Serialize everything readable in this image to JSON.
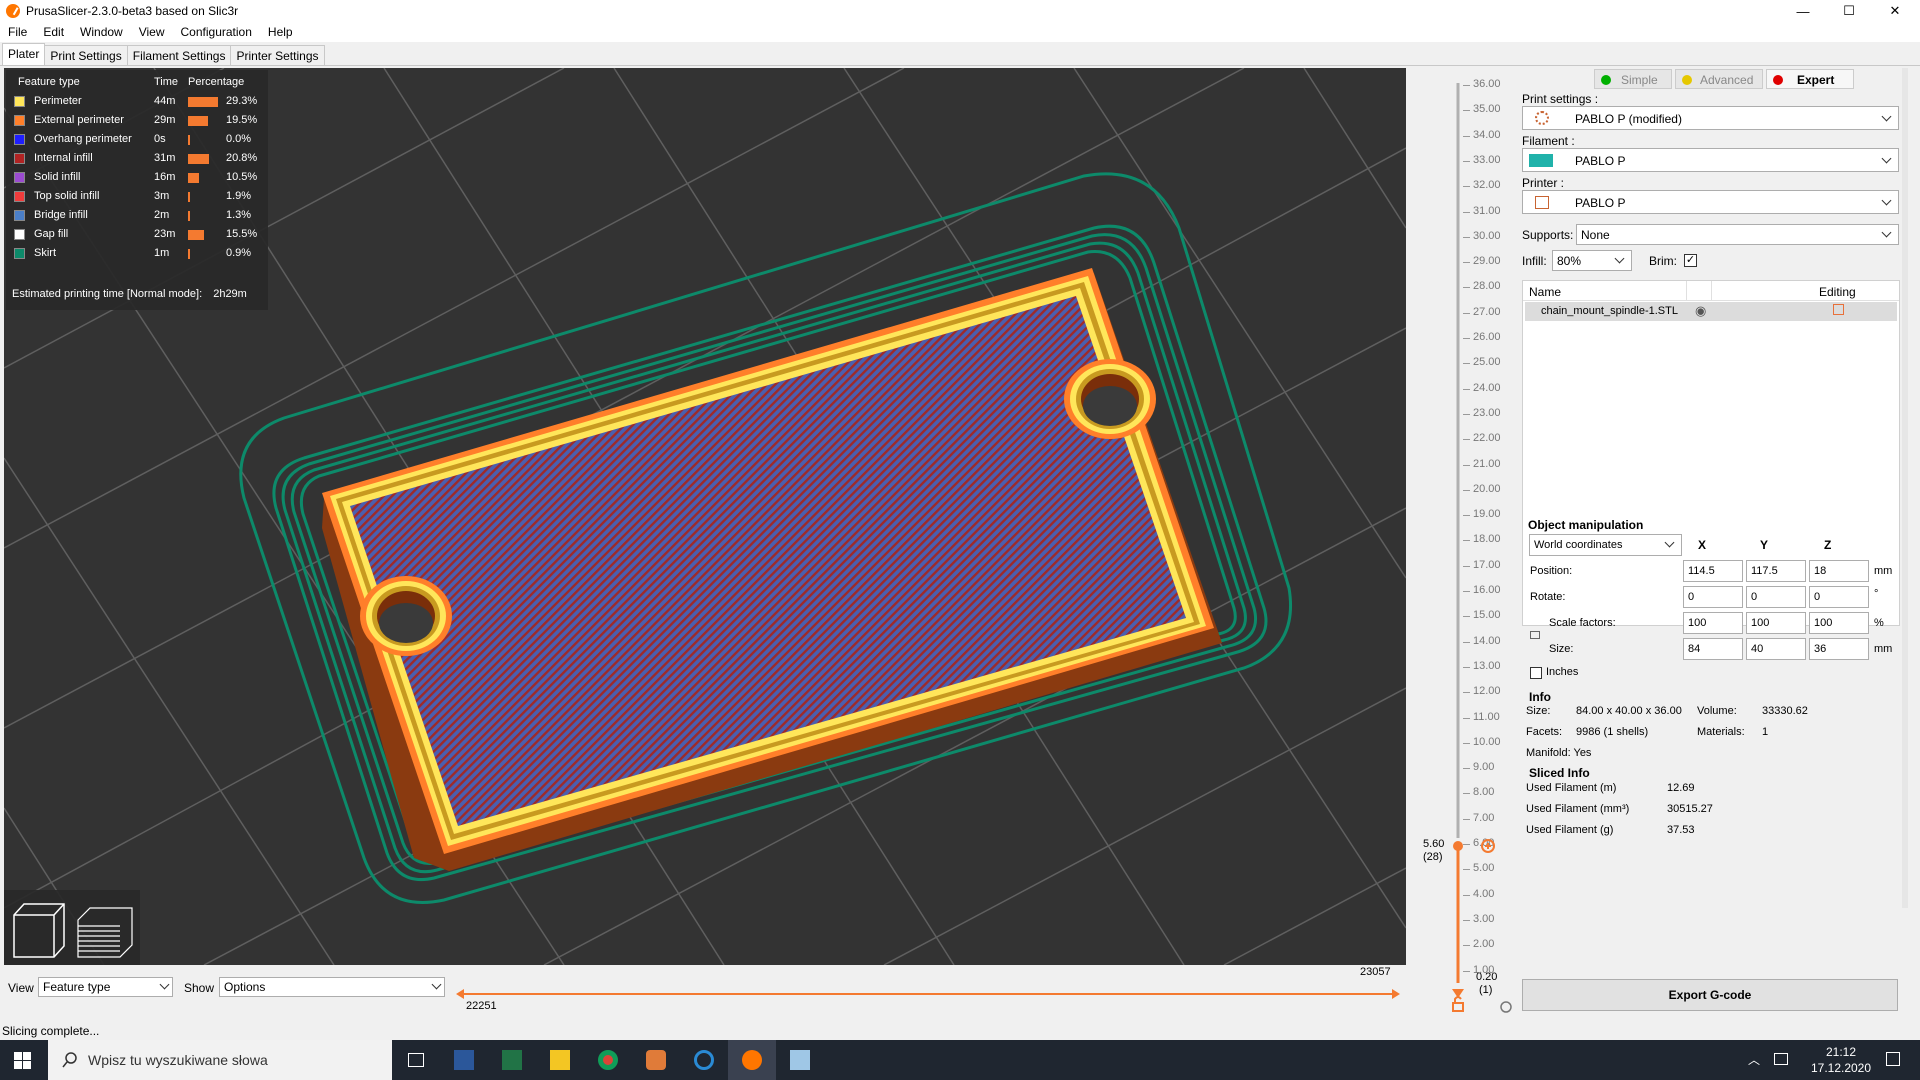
{
  "window": {
    "title": "PrusaSlicer-2.3.0-beta3 based on Slic3r",
    "controls": {
      "minimize": "—",
      "maximize": "☐",
      "close": "✕"
    }
  },
  "menu": [
    "File",
    "Edit",
    "Window",
    "View",
    "Configuration",
    "Help"
  ],
  "tabs": [
    "Plater",
    "Print Settings",
    "Filament Settings",
    "Printer Settings"
  ],
  "legend": {
    "headers": {
      "feature": "Feature type",
      "time": "Time",
      "percentage": "Percentage"
    },
    "rows": [
      {
        "name": "Perimeter",
        "time": "44m",
        "pct": "29.3%",
        "value": 29.3,
        "color": "#ffe65a"
      },
      {
        "name": "External perimeter",
        "time": "29m",
        "pct": "19.5%",
        "value": 19.5,
        "color": "#ff7f2a"
      },
      {
        "name": "Overhang perimeter",
        "time": "0s",
        "pct": "0.0%",
        "value": 0.0,
        "color": "#1f1fff"
      },
      {
        "name": "Internal infill",
        "time": "31m",
        "pct": "20.8%",
        "value": 20.8,
        "color": "#b12323"
      },
      {
        "name": "Solid infill",
        "time": "16m",
        "pct": "10.5%",
        "value": 10.5,
        "color": "#9b4bd0"
      },
      {
        "name": "Top solid infill",
        "time": "3m",
        "pct": "1.9%",
        "value": 1.9,
        "color": "#f03c3c"
      },
      {
        "name": "Bridge infill",
        "time": "2m",
        "pct": "1.3%",
        "value": 1.3,
        "color": "#4b7fc8"
      },
      {
        "name": "Gap fill",
        "time": "23m",
        "pct": "15.5%",
        "value": 15.5,
        "color": "#ffffff"
      },
      {
        "name": "Skirt",
        "time": "1m",
        "pct": "0.9%",
        "value": 0.9,
        "color": "#0d8a6a"
      }
    ],
    "estimated": "Estimated printing time [Normal mode]:",
    "estimated_value": "2h29m"
  },
  "bottom": {
    "view_label": "View",
    "view_value": "Feature type",
    "show_label": "Show",
    "show_value": "Options",
    "h_slider_left": "22251",
    "h_slider_right": "23057"
  },
  "vslider": {
    "ticks": [
      "36.00",
      "35.00",
      "34.00",
      "33.00",
      "32.00",
      "31.00",
      "30.00",
      "29.00",
      "28.00",
      "27.00",
      "26.00",
      "25.00",
      "24.00",
      "23.00",
      "22.00",
      "21.00",
      "20.00",
      "19.00",
      "18.00",
      "17.00",
      "16.00",
      "15.00",
      "14.00",
      "13.00",
      "12.00",
      "11.00",
      "10.00",
      "9.00",
      "8.00",
      "7.00",
      "6.00",
      "5.00",
      "4.00",
      "3.00",
      "2.00",
      "1.00"
    ],
    "current_value": "5.60",
    "current_layer": "(28)",
    "bottom_value": "0.20",
    "bottom_layer": "(1)"
  },
  "sidebar": {
    "modes": [
      "Simple",
      "Advanced",
      "Expert"
    ],
    "mode_colors": [
      "#00b000",
      "#e6c800",
      "#e00000"
    ],
    "print_settings_label": "Print settings :",
    "print_settings_value": "PABLO P (modified)",
    "filament_label": "Filament :",
    "filament_value": "PABLO P",
    "filament_color": "#20b2aa",
    "printer_label": "Printer :",
    "printer_value": "PABLO P",
    "supports_label": "Supports:",
    "supports_value": "None",
    "infill_label": "Infill:",
    "infill_value": "80%",
    "brim_label": "Brim:",
    "objlist": {
      "col_name": "Name",
      "col_editing": "Editing",
      "object": "chain_mount_spindle-1.STL"
    },
    "manip": {
      "title": "Object manipulation",
      "coords": "World coordinates",
      "axes": [
        "X",
        "Y",
        "Z"
      ],
      "rows": [
        {
          "label": "Position:",
          "values": [
            "114.5",
            "117.5",
            "18"
          ],
          "unit": "mm"
        },
        {
          "label": "Rotate:",
          "values": [
            "0",
            "0",
            "0"
          ],
          "unit": "°"
        },
        {
          "label": "Scale factors:",
          "values": [
            "100",
            "100",
            "100"
          ],
          "unit": "%"
        },
        {
          "label": "Size:",
          "values": [
            "84",
            "40",
            "36"
          ],
          "unit": "mm"
        }
      ],
      "inches": "Inches"
    },
    "info": {
      "title": "Info",
      "size_label": "Size:",
      "size_value": "84.00 x 40.00 x 36.00",
      "volume_label": "Volume:",
      "volume_value": "33330.62",
      "facets_label": "Facets:",
      "facets_value": "9986 (1 shells)",
      "materials_label": "Materials:",
      "materials_value": "1",
      "manifold": "Manifold: Yes"
    },
    "sliced": {
      "title": "Sliced Info",
      "rows": [
        {
          "label": "Used Filament (m)",
          "value": "12.69"
        },
        {
          "label": "Used Filament (mm³)",
          "value": "30515.27"
        },
        {
          "label": "Used Filament (g)",
          "value": "37.53"
        }
      ]
    },
    "export": "Export G-code"
  },
  "status": "Slicing complete...",
  "taskbar": {
    "search_placeholder": "Wpisz tu wyszukiwane słowa",
    "time": "21:12",
    "date": "17.12.2020"
  }
}
